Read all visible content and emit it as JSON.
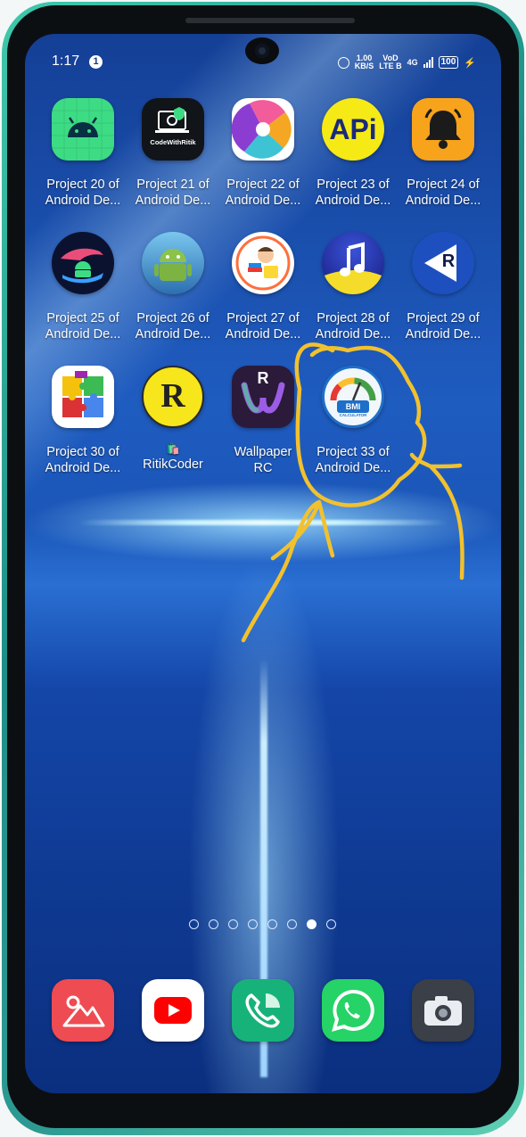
{
  "status_bar": {
    "time": "1:17",
    "notification_count": "1",
    "speed_value": "1.00",
    "speed_unit": "KB/S",
    "volte_top": "VoD",
    "volte_bottom": "LTE B",
    "network": "4G",
    "battery": "100"
  },
  "apps": [
    {
      "line1": "Project 20 of",
      "line2": "Android De...",
      "icon": "android-icon"
    },
    {
      "line1": "Project 21 of",
      "line2": "Android De...",
      "icon": "codewithritik-icon",
      "icon_text": "CodeWithRitik"
    },
    {
      "line1": "Project 22 of",
      "line2": "Android De...",
      "icon": "pinwheel-icon"
    },
    {
      "line1": "Project 23 of",
      "line2": "Android De...",
      "icon": "api-icon",
      "icon_text": "APi"
    },
    {
      "line1": "Project 24 of",
      "line2": "Android De...",
      "icon": "bell-icon"
    },
    {
      "line1": "Project 25 of",
      "line2": "Android De...",
      "icon": "hand-android-icon"
    },
    {
      "line1": "Project 26 of",
      "line2": "Android De...",
      "icon": "android-3d-icon"
    },
    {
      "line1": "Project 27 of",
      "line2": "Android De...",
      "icon": "kid-books-icon"
    },
    {
      "line1": "Project 28 of",
      "line2": "Android De...",
      "icon": "music-note-icon"
    },
    {
      "line1": "Project 29 of",
      "line2": "Android De...",
      "icon": "r-play-icon",
      "icon_text": "R"
    },
    {
      "line1": "Project 30 of",
      "line2": "Android De...",
      "icon": "puzzle-icon"
    },
    {
      "line1": "RitikCoder",
      "line2": "",
      "icon": "ritikcoder-icon",
      "icon_text": "R"
    },
    {
      "line1": "Wallpaper",
      "line2": "RC",
      "icon": "wallpaper-rc-icon",
      "icon_text": "R"
    },
    {
      "line1": "Project 33 of",
      "line2": "Android De...",
      "icon": "bmi-calculator-icon",
      "icon_text": "BMI",
      "icon_subtext": "CALCULATOR"
    }
  ],
  "page_indicator": {
    "count": 8,
    "active_index": 6
  },
  "dock": [
    {
      "icon": "gallery-icon"
    },
    {
      "icon": "youtube-icon"
    },
    {
      "icon": "phone-icon"
    },
    {
      "icon": "whatsapp-icon"
    },
    {
      "icon": "camera-icon"
    }
  ],
  "colors": {
    "annotation": "#f2c12e",
    "wallpaper": "#1f5cc0"
  }
}
